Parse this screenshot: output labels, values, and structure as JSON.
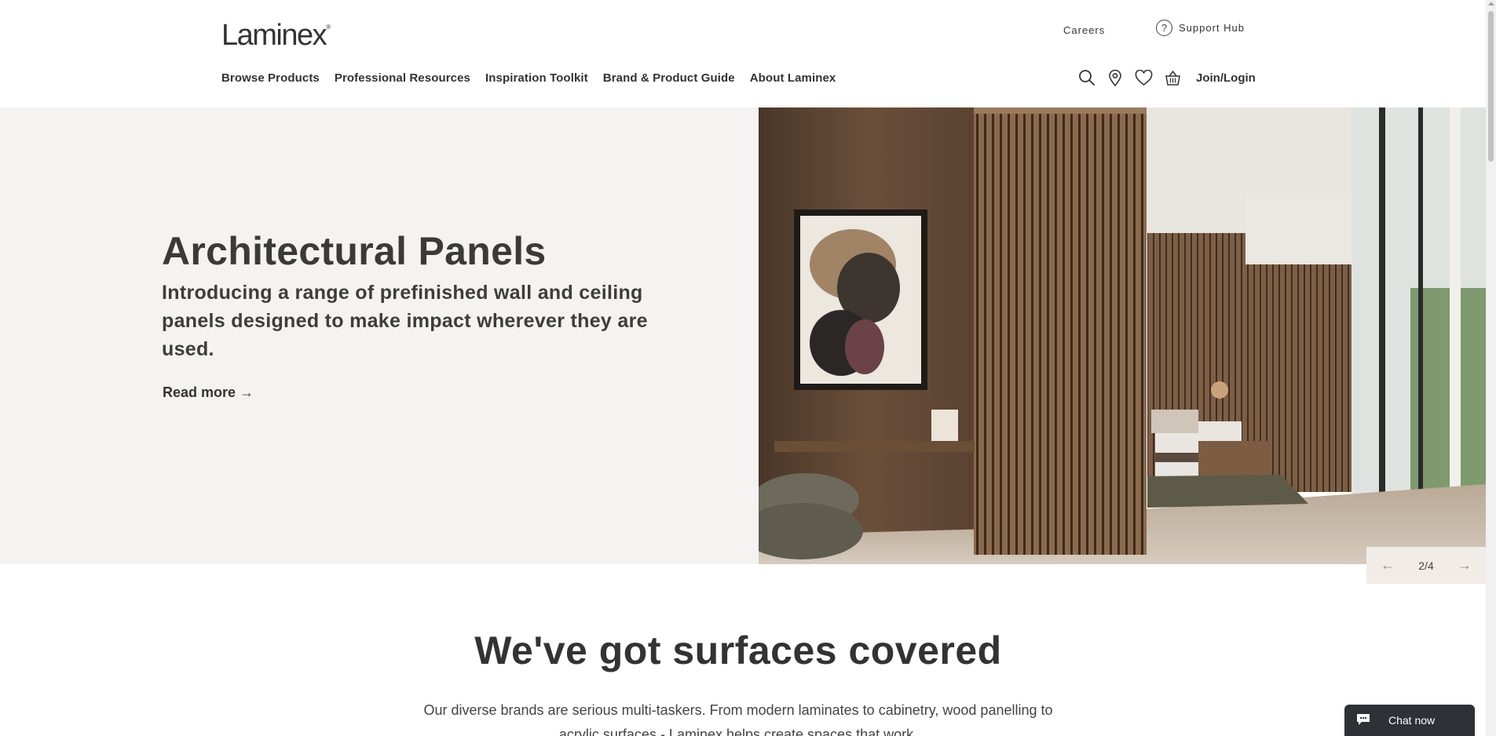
{
  "header": {
    "logo": "Laminex",
    "logo_mark": "®",
    "careers": "Careers",
    "support_hub": "Support Hub",
    "support_icon": "question-circle-icon",
    "nav": [
      {
        "label": "Browse Products"
      },
      {
        "label": "Professional Resources"
      },
      {
        "label": "Inspiration Toolkit"
      },
      {
        "label": "Brand & Product Guide"
      },
      {
        "label": "About Laminex"
      }
    ],
    "icons": [
      "search-icon",
      "location-pin-icon",
      "heart-icon",
      "basket-icon"
    ],
    "join_login": "Join/Login"
  },
  "hero": {
    "title": "Architectural Panels",
    "description": "Introducing a range of prefinished wall and ceiling panels designed to make impact wherever they are used.",
    "link": "Read more →",
    "slider": {
      "current": 2,
      "total": 4,
      "counter_text": "2/4",
      "prev": "←",
      "next": "→"
    }
  },
  "section": {
    "title": "We've got surfaces covered",
    "body": "Our diverse brands are serious multi-taskers. From modern laminates to cabinetry, wood panelling to acrylic surfaces - Laminex helps create spaces that work."
  },
  "chat": {
    "label": "Chat now",
    "icon": "chat-bubble-icon"
  },
  "colors": {
    "hero_bg": "#f4f3f1",
    "text": "#333333",
    "chat_bg": "#2f3136",
    "slider_bg": "#f1ece7"
  }
}
